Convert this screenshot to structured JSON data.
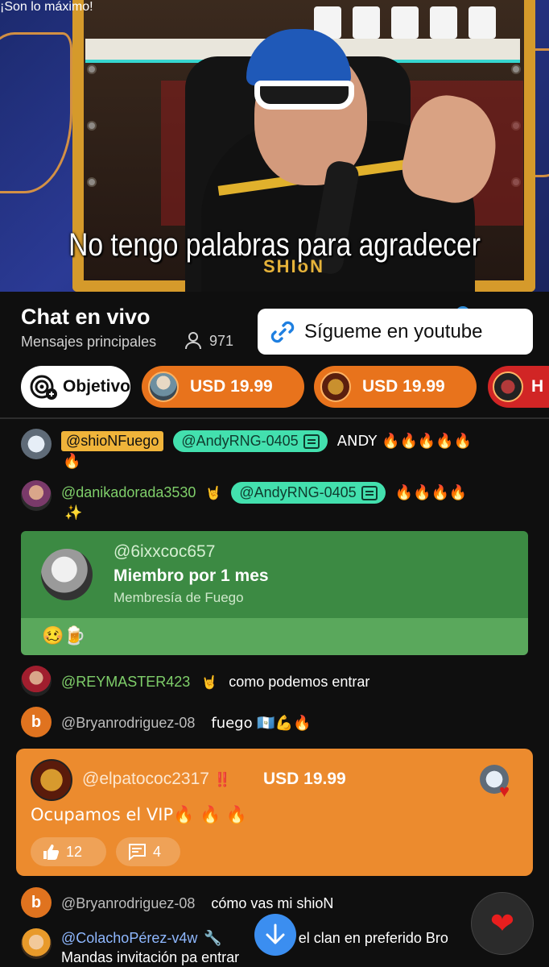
{
  "video": {
    "brand_text": "SHIoN",
    "caption_line1": "No tengo palabras para agradecer",
    "caption_line2": "¡Son lo máximo!"
  },
  "chat": {
    "title": "Chat en vivo",
    "subtitle": "Mensajes principales",
    "viewer_count": "971",
    "follow_button_label": "Sígueme en youtube"
  },
  "chips": {
    "goal_label": "Objetivo",
    "usd1": "USD 19.99",
    "usd2": "USD 19.99",
    "red_label": "H"
  },
  "messages": [
    {
      "author": "@shioNFuego",
      "mention": "@AndyRNG-0405",
      "text": "ANDY 🔥🔥🔥🔥🔥",
      "cont": "🔥"
    },
    {
      "author": "@danikadorada3530",
      "badge": "🤘",
      "mention": "@AndyRNG-0405",
      "text": "🔥🔥🔥🔥",
      "cont": "✨"
    },
    {
      "author": "@REYMASTER423",
      "badge": "🤘",
      "text": "como podemos entrar"
    },
    {
      "author": "@Bryanrodriguez-08",
      "text": "fuego 🇬🇹💪🔥",
      "initial": "b"
    },
    {
      "author": "@Bryanrodriguez-08",
      "text": "cómo vas mi shioN",
      "initial": "b"
    },
    {
      "author": "@ColachoPérez-v4w",
      "badge": "🔧",
      "text": "en el clan en preferido Bro",
      "cont": "Mandas invitación pa entrar"
    }
  ],
  "membership": {
    "author": "@6ixxcoc657",
    "title": "Miembro por 1 mes",
    "subtitle": "Membresía de Fuego",
    "emoji": "🥴🍺"
  },
  "superchat": {
    "author": "@elpatococ2317",
    "badge": "‼️",
    "amount": "USD 19.99",
    "text": "Ocupamos el VIP🔥 🔥 🔥",
    "likes": "12",
    "replies": "4"
  },
  "colors": {
    "accent_orange": "#e8731c",
    "member_green": "#3c8a43",
    "mention_teal": "#43e0ae",
    "fab_blue": "#3b8ef0"
  }
}
